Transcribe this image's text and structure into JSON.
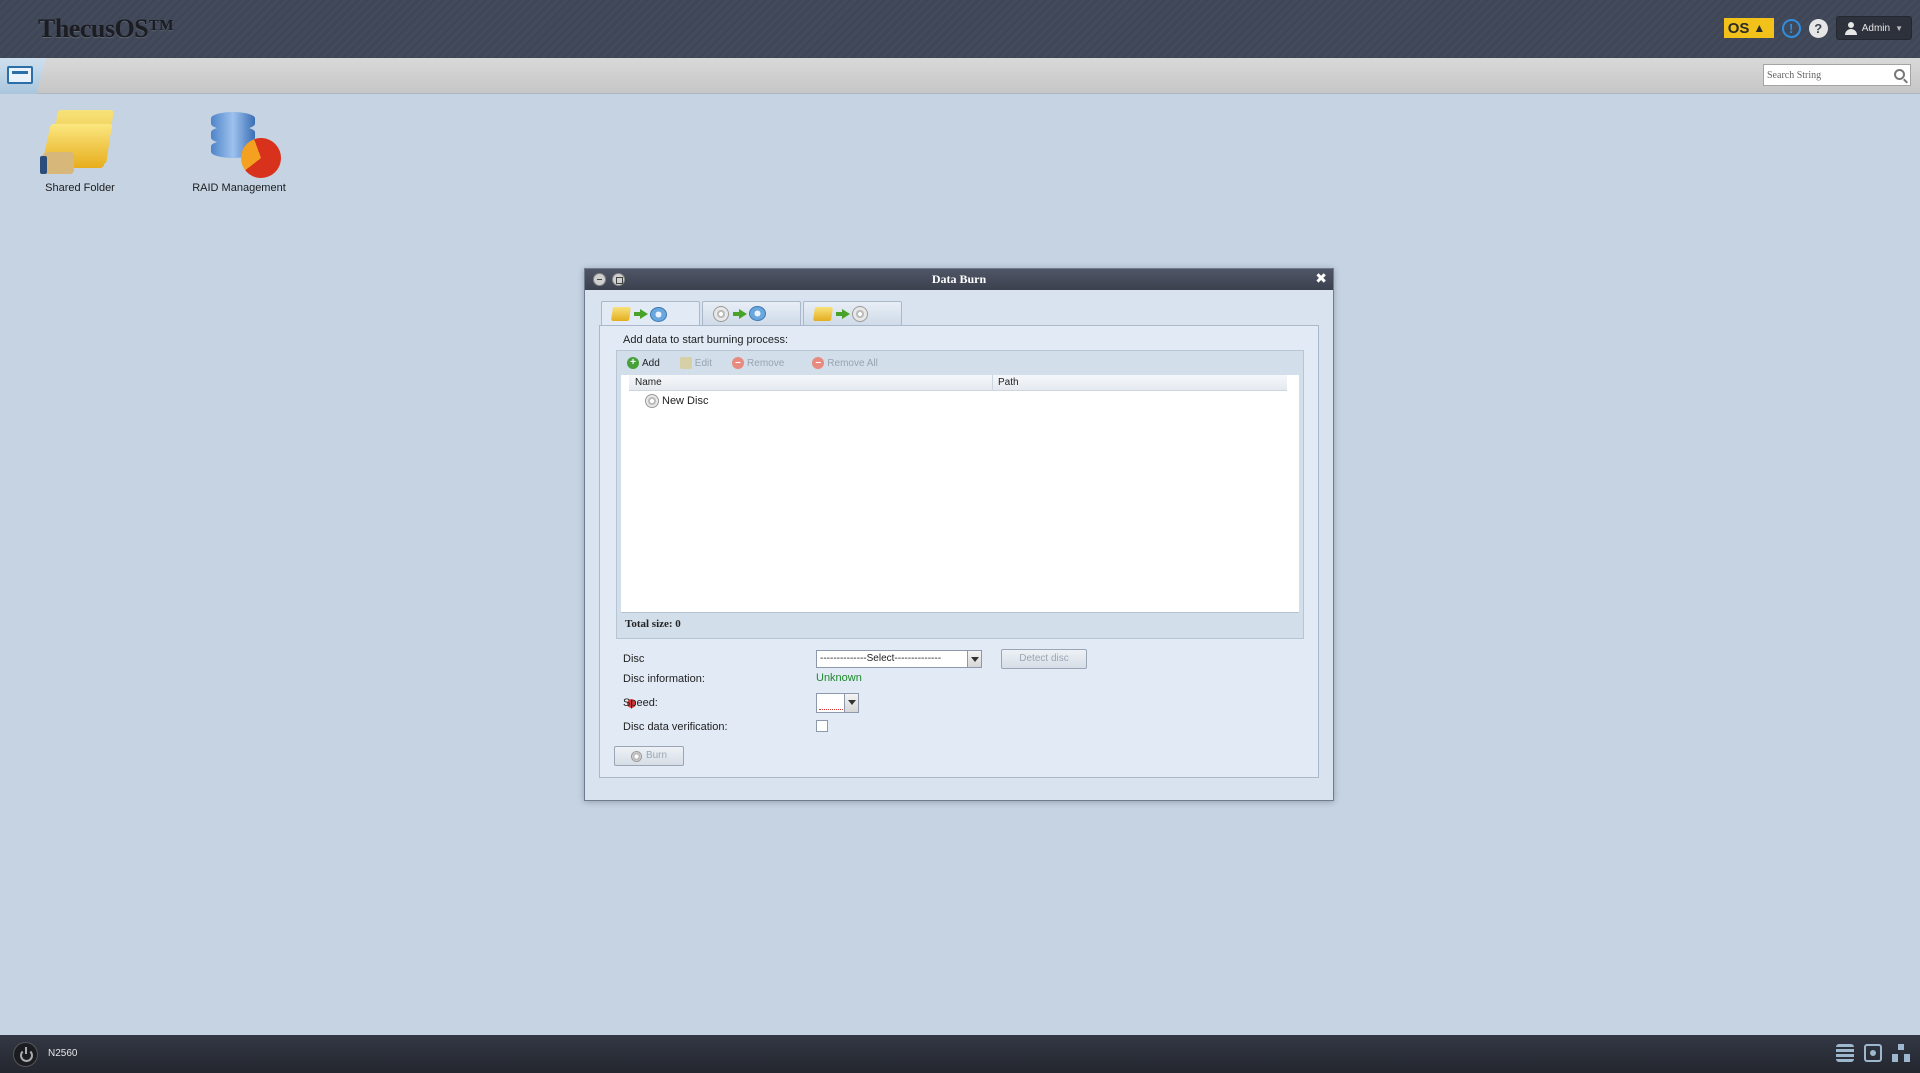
{
  "header": {
    "brand": "ThecusOS™",
    "os_badge": "OS",
    "user": "Admin"
  },
  "toolbar": {
    "search_placeholder": "Search String"
  },
  "desktop": {
    "icons": [
      {
        "label": "Shared Folder",
        "icon": "shared-folder-icon"
      },
      {
        "label": "RAID Management",
        "icon": "raid-management-icon"
      }
    ]
  },
  "window": {
    "title": "Data Burn",
    "tabs": [
      {
        "icon": "folder-to-disc",
        "active": true
      },
      {
        "icon": "disc-to-disc",
        "active": false
      },
      {
        "icon": "folder-to-image",
        "active": false
      }
    ],
    "heading": "Add data to start burning process:",
    "grid_toolbar": {
      "add": "Add",
      "edit": "Edit",
      "remove": "Remove",
      "remove_all": "Remove All"
    },
    "columns": [
      "Name",
      "Path"
    ],
    "rows": [
      {
        "name": "New Disc",
        "path": ""
      }
    ],
    "total_size": "Total size: 0",
    "form": {
      "disc_label": "Disc",
      "disc_select": "--------------Select--------------",
      "detect_disc": "Detect disc",
      "disc_info_label": "Disc information:",
      "disc_info_value": "Unknown",
      "speed_label": "Speed:",
      "verification_label": "Disc data verification:",
      "burn_button": "Burn"
    }
  },
  "taskbar": {
    "model": "N2560"
  },
  "colors": {
    "desktop_bg": "#c5d3e3",
    "header_bg": "#3f4656",
    "status_ok": "#1c8a2a",
    "error": "#d9383a"
  }
}
